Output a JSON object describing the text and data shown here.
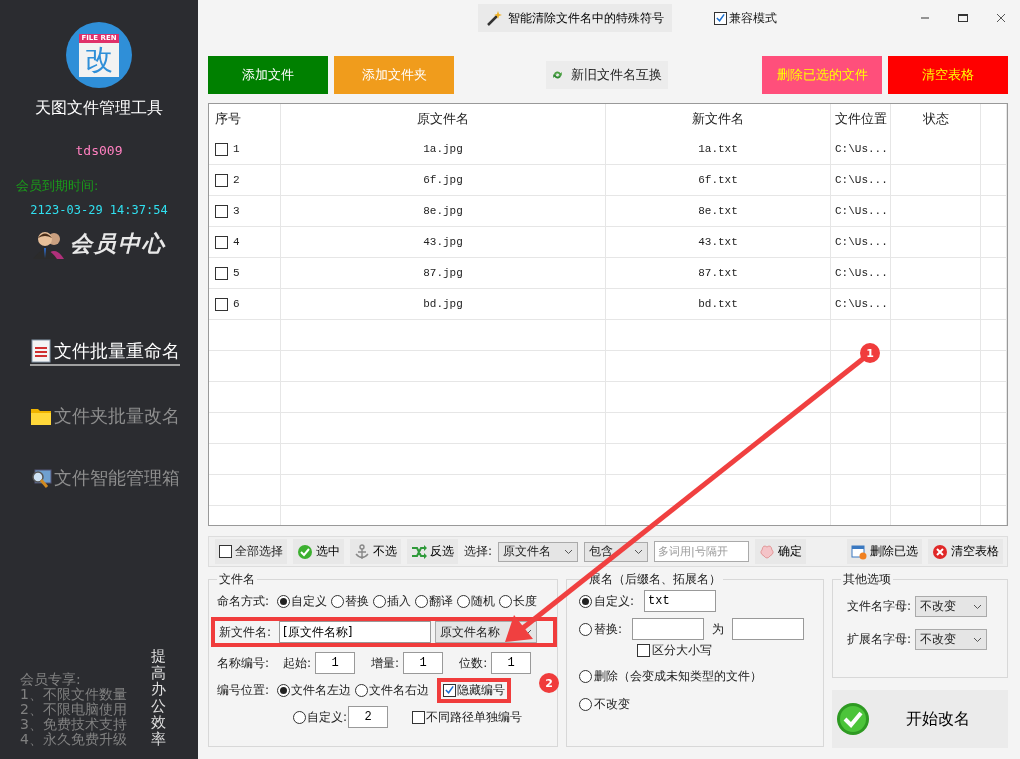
{
  "sidebar": {
    "logo": {
      "badge": "FILE REN",
      "glyph": "改"
    },
    "app_title": "天图文件管理工具",
    "username": "tds009",
    "expiry_label": "会员到期时间:",
    "expiry_time": "2123-03-29 14:37:54",
    "member_center": "会员中心",
    "nav": [
      {
        "label": "文件批量重命名",
        "selected": true
      },
      {
        "label": "文件夹批量改名",
        "selected": false
      },
      {
        "label": "文件智能管理箱",
        "selected": false
      }
    ],
    "perks": {
      "title": "会员专享:",
      "items": [
        "1、不限文件数量",
        "2、不限电脑使用",
        "3、免费技术支持",
        "4、永久免费升级"
      ]
    },
    "slogan": "提高办公效率"
  },
  "top_bar": {
    "clean_button": "智能清除文件名中的特殊符号",
    "compat_mode": {
      "label": "兼容模式",
      "checked": true
    }
  },
  "actions": [
    {
      "label": "添加文件",
      "kind": "add",
      "color": "#008000"
    },
    {
      "label": "添加文件夹",
      "kind": "add",
      "color": "#f09c1c"
    },
    {
      "label": "新旧文件名互换",
      "kind": "swap"
    },
    {
      "label": "删除已选的文件",
      "kind": "remove",
      "color": "#ff4f7b"
    },
    {
      "label": "清空表格",
      "kind": "remove",
      "color": "#ff0000"
    }
  ],
  "table": {
    "columns": [
      "序号",
      "原文件名",
      "新文件名",
      "文件位置",
      "状态"
    ],
    "rows": [
      {
        "checked": false,
        "number": "1",
        "original": "1a.jpg",
        "new": "1a.txt",
        "location": "C:\\Us..."
      },
      {
        "checked": false,
        "number": "2",
        "original": "6f.jpg",
        "new": "6f.txt",
        "location": "C:\\Us..."
      },
      {
        "checked": false,
        "number": "3",
        "original": "8e.jpg",
        "new": "8e.txt",
        "location": "C:\\Us..."
      },
      {
        "checked": false,
        "number": "4",
        "original": "43.jpg",
        "new": "43.txt",
        "location": "C:\\Us..."
      },
      {
        "checked": false,
        "number": "5",
        "original": "87.jpg",
        "new": "87.txt",
        "location": "C:\\Us..."
      },
      {
        "checked": false,
        "number": "6",
        "original": "bd.jpg",
        "new": "bd.txt",
        "location": "C:\\Us..."
      }
    ]
  },
  "selection_bar": {
    "select_all": {
      "label": "全部选择",
      "checked": false
    },
    "select": "选中",
    "deselect": "不选",
    "invert": "反选",
    "select_label": "选择:",
    "field": "原文件名",
    "match": "包含",
    "keyword_placeholder": "多词用|号隔开",
    "confirm": "确定",
    "delete_selected": "删除已选",
    "clear_table": "清空表格"
  },
  "filename_group": {
    "title": "文件名",
    "naming_label": "命名方式:",
    "naming_modes": [
      {
        "label": "自定义",
        "selected": true
      },
      {
        "label": "替换",
        "selected": false
      },
      {
        "label": "插入",
        "selected": false
      },
      {
        "label": "翻译",
        "selected": false
      },
      {
        "label": "随机",
        "selected": false
      },
      {
        "label": "长度",
        "selected": false
      }
    ],
    "new_name_label": "新文件名:",
    "new_name_value": "[原文件名称]",
    "name_source": "原文件名称",
    "numbering_label": "名称编号:",
    "start_label": "起始:",
    "start_value": "1",
    "step_label": "增量:",
    "step_value": "1",
    "digits_label": "位数:",
    "digits_value": "1",
    "position_label": "编号位置:",
    "positions": [
      {
        "label": "文件名左边",
        "selected": true
      },
      {
        "label": "文件名右边",
        "selected": false
      },
      {
        "label": "自定义:",
        "selected": false,
        "value": "2"
      }
    ],
    "hide_number": {
      "label": "隐藏编号",
      "checked": true
    },
    "separate_numbering": {
      "label": "不同路径单独编号",
      "checked": false
    }
  },
  "extension_group": {
    "title": "展名（后缀名、拓展名）",
    "options": [
      {
        "kind": "custom",
        "label": "自定义:",
        "selected": true,
        "value": "txt"
      },
      {
        "kind": "replace",
        "label": "替换:",
        "selected": false,
        "connector": "为",
        "case_sensitive": {
          "label": "区分大小写",
          "checked": false
        }
      },
      {
        "kind": "plain",
        "label": "删除（会变成未知类型的文件）",
        "selected": false
      },
      {
        "kind": "plain",
        "label": "不改变",
        "selected": false
      }
    ]
  },
  "other_group": {
    "title": "其他选项",
    "rows": [
      {
        "label": "文件名字母:",
        "value": "不改变"
      },
      {
        "label": "扩展名字母:",
        "value": "不改变"
      }
    ]
  },
  "start_button": "开始改名",
  "annotations": [
    "1",
    "2"
  ]
}
